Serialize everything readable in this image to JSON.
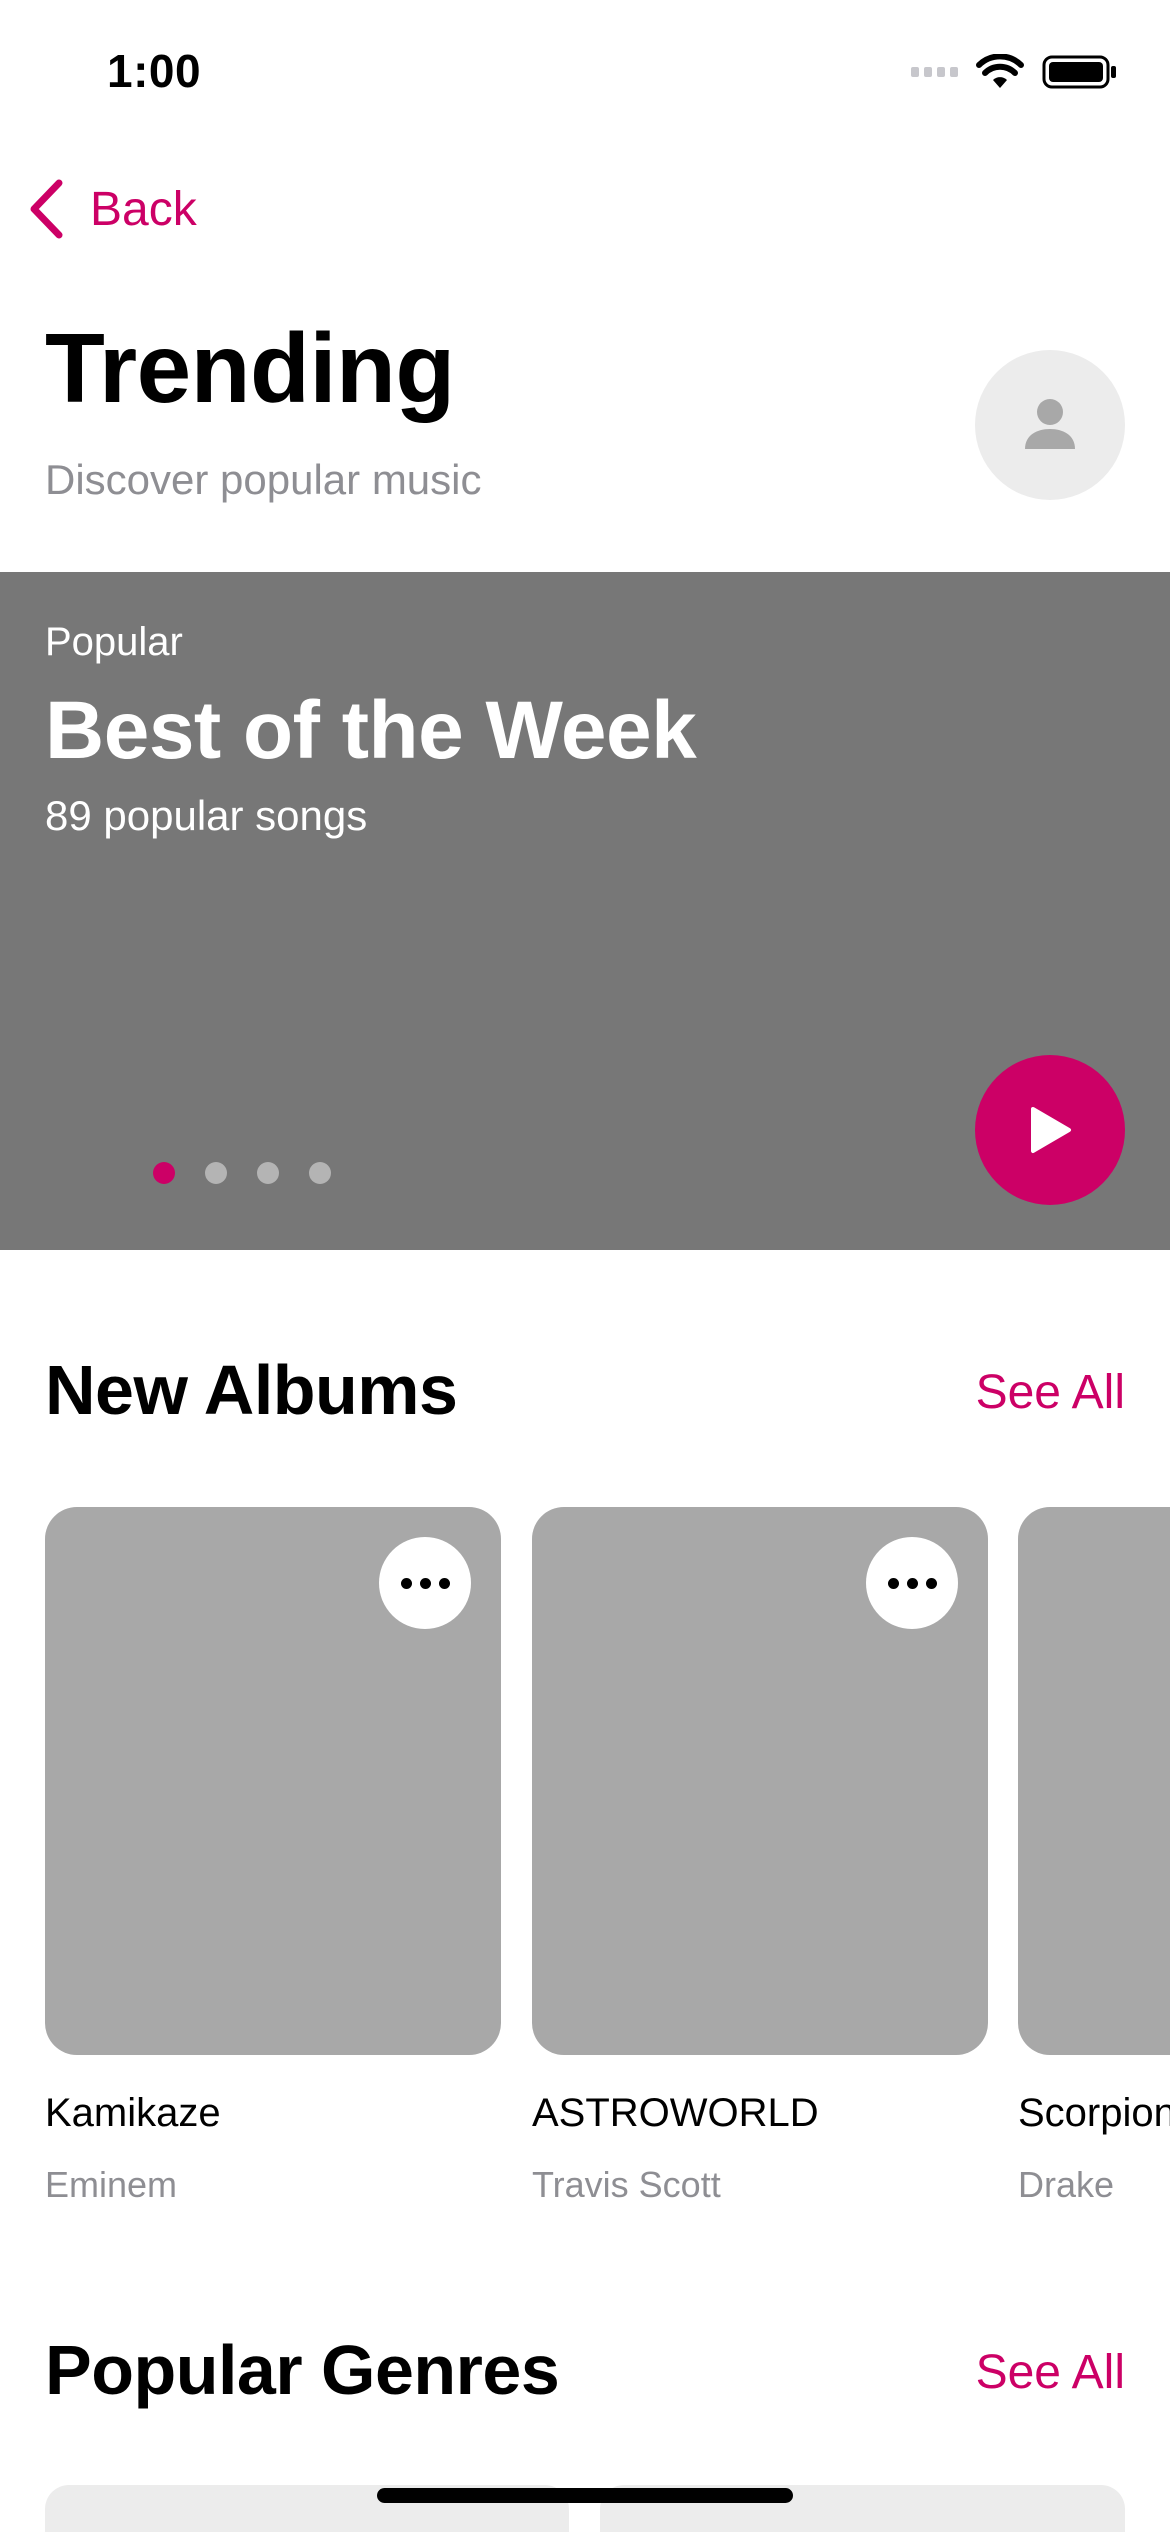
{
  "status_bar": {
    "time": "1:00"
  },
  "nav": {
    "back_label": "Back"
  },
  "header": {
    "title": "Trending",
    "subtitle": "Discover popular music"
  },
  "hero": {
    "eyebrow": "Popular",
    "title": "Best of the Week",
    "meta": "89 popular songs",
    "page_count": 4,
    "active_page": 1
  },
  "new_albums": {
    "title": "New Albums",
    "see_all": "See All",
    "items": [
      {
        "title": "Kamikaze",
        "artist": "Eminem"
      },
      {
        "title": "ASTROWORLD",
        "artist": "Travis Scott"
      },
      {
        "title": "Scorpion",
        "artist": "Drake"
      }
    ]
  },
  "popular_genres": {
    "title": "Popular Genres",
    "see_all": "See All"
  },
  "colors": {
    "accent": "#cc0066",
    "hero_bg": "#777777",
    "placeholder": "#a8a8a8",
    "secondary_text": "#8e8e93"
  }
}
